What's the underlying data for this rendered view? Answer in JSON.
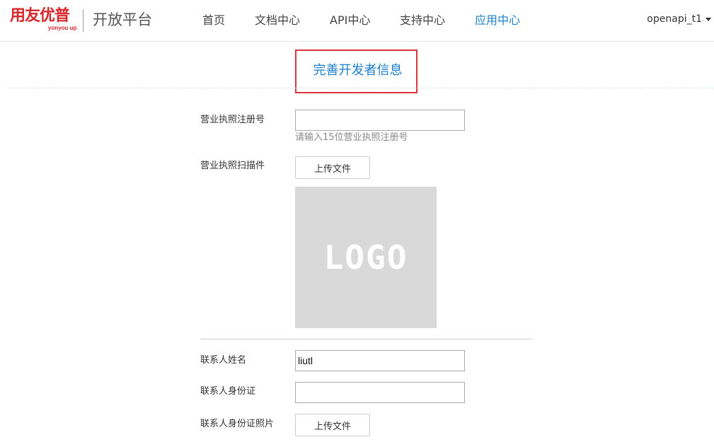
{
  "header": {
    "logo_text": "用友优普",
    "logo_subtext": "yonyou up",
    "platform_title": "开放平台",
    "nav": [
      {
        "label": "首页",
        "active": false
      },
      {
        "label": "文档中心",
        "active": false
      },
      {
        "label": "API中心",
        "active": false
      },
      {
        "label": "支持中心",
        "active": false
      },
      {
        "label": "应用中心",
        "active": true
      }
    ],
    "user": "openapi_t1"
  },
  "page": {
    "title": "完善开发者信息"
  },
  "form": {
    "license_number": {
      "label": "营业执照注册号",
      "value": "",
      "hint": "请输入15位营业执照注册号"
    },
    "license_scan": {
      "label": "营业执照扫描件",
      "upload_label": "上传文件",
      "preview_text": "LOGO"
    },
    "contact_name": {
      "label": "联系人姓名",
      "value": "liutl"
    },
    "contact_id": {
      "label": "联系人身份证",
      "value": ""
    },
    "contact_id_photo": {
      "label": "联系人身份证照片",
      "upload_label": "上传文件"
    }
  },
  "colors": {
    "brand_red": "#d9262b",
    "accent_blue": "#1e7fcb",
    "highlight_border": "#d9363e"
  }
}
